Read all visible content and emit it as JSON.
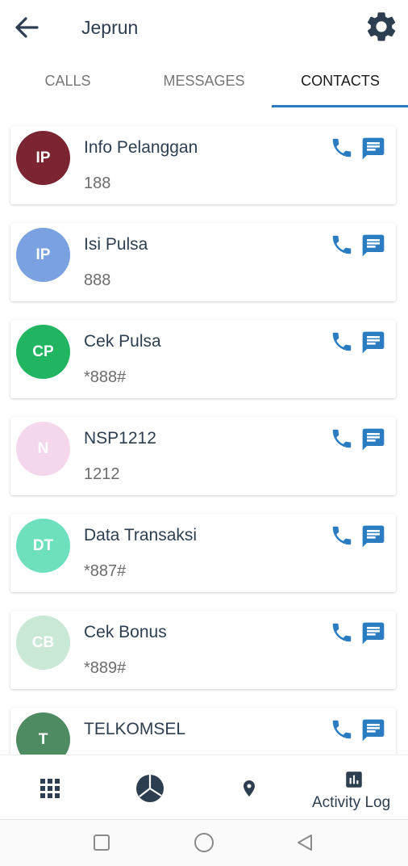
{
  "header": {
    "title": "Jeprun"
  },
  "tabs": [
    {
      "label": "CALLS"
    },
    {
      "label": "MESSAGES"
    },
    {
      "label": "CONTACTS"
    }
  ],
  "contacts": [
    {
      "initials": "IP",
      "name": "Info Pelanggan",
      "number": "188",
      "color": "#7b2432"
    },
    {
      "initials": "IP",
      "name": "Isi Pulsa",
      "number": "888",
      "color": "#7aa1e0"
    },
    {
      "initials": "CP",
      "name": "Cek Pulsa",
      "number": "*888#",
      "color": "#21b562"
    },
    {
      "initials": "N",
      "name": "NSP1212",
      "number": "1212",
      "color": "#f5d7ec"
    },
    {
      "initials": "DT",
      "name": "Data Transaksi",
      "number": "*887#",
      "color": "#6fe0bd"
    },
    {
      "initials": "CB",
      "name": "Cek Bonus",
      "number": "*889#",
      "color": "#c9e8d6"
    },
    {
      "initials": "T",
      "name": "TELKOMSEL",
      "number": "",
      "color": "#4e8a62"
    }
  ],
  "bottom_nav": {
    "activity_label": "Activity Log"
  },
  "colors": {
    "accent": "#2a7bc0",
    "icon_dark": "#2c3e50"
  }
}
